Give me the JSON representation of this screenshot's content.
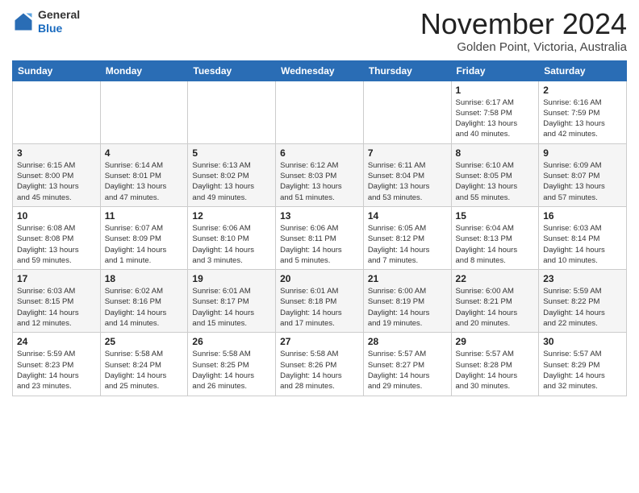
{
  "header": {
    "logo": {
      "line1": "General",
      "line2": "Blue"
    },
    "title": "November 2024",
    "location": "Golden Point, Victoria, Australia"
  },
  "calendar": {
    "weekdays": [
      "Sunday",
      "Monday",
      "Tuesday",
      "Wednesday",
      "Thursday",
      "Friday",
      "Saturday"
    ],
    "weeks": [
      [
        {
          "day": "",
          "info": ""
        },
        {
          "day": "",
          "info": ""
        },
        {
          "day": "",
          "info": ""
        },
        {
          "day": "",
          "info": ""
        },
        {
          "day": "",
          "info": ""
        },
        {
          "day": "1",
          "info": "Sunrise: 6:17 AM\nSunset: 7:58 PM\nDaylight: 13 hours\nand 40 minutes."
        },
        {
          "day": "2",
          "info": "Sunrise: 6:16 AM\nSunset: 7:59 PM\nDaylight: 13 hours\nand 42 minutes."
        }
      ],
      [
        {
          "day": "3",
          "info": "Sunrise: 6:15 AM\nSunset: 8:00 PM\nDaylight: 13 hours\nand 45 minutes."
        },
        {
          "day": "4",
          "info": "Sunrise: 6:14 AM\nSunset: 8:01 PM\nDaylight: 13 hours\nand 47 minutes."
        },
        {
          "day": "5",
          "info": "Sunrise: 6:13 AM\nSunset: 8:02 PM\nDaylight: 13 hours\nand 49 minutes."
        },
        {
          "day": "6",
          "info": "Sunrise: 6:12 AM\nSunset: 8:03 PM\nDaylight: 13 hours\nand 51 minutes."
        },
        {
          "day": "7",
          "info": "Sunrise: 6:11 AM\nSunset: 8:04 PM\nDaylight: 13 hours\nand 53 minutes."
        },
        {
          "day": "8",
          "info": "Sunrise: 6:10 AM\nSunset: 8:05 PM\nDaylight: 13 hours\nand 55 minutes."
        },
        {
          "day": "9",
          "info": "Sunrise: 6:09 AM\nSunset: 8:07 PM\nDaylight: 13 hours\nand 57 minutes."
        }
      ],
      [
        {
          "day": "10",
          "info": "Sunrise: 6:08 AM\nSunset: 8:08 PM\nDaylight: 13 hours\nand 59 minutes."
        },
        {
          "day": "11",
          "info": "Sunrise: 6:07 AM\nSunset: 8:09 PM\nDaylight: 14 hours\nand 1 minute."
        },
        {
          "day": "12",
          "info": "Sunrise: 6:06 AM\nSunset: 8:10 PM\nDaylight: 14 hours\nand 3 minutes."
        },
        {
          "day": "13",
          "info": "Sunrise: 6:06 AM\nSunset: 8:11 PM\nDaylight: 14 hours\nand 5 minutes."
        },
        {
          "day": "14",
          "info": "Sunrise: 6:05 AM\nSunset: 8:12 PM\nDaylight: 14 hours\nand 7 minutes."
        },
        {
          "day": "15",
          "info": "Sunrise: 6:04 AM\nSunset: 8:13 PM\nDaylight: 14 hours\nand 8 minutes."
        },
        {
          "day": "16",
          "info": "Sunrise: 6:03 AM\nSunset: 8:14 PM\nDaylight: 14 hours\nand 10 minutes."
        }
      ],
      [
        {
          "day": "17",
          "info": "Sunrise: 6:03 AM\nSunset: 8:15 PM\nDaylight: 14 hours\nand 12 minutes."
        },
        {
          "day": "18",
          "info": "Sunrise: 6:02 AM\nSunset: 8:16 PM\nDaylight: 14 hours\nand 14 minutes."
        },
        {
          "day": "19",
          "info": "Sunrise: 6:01 AM\nSunset: 8:17 PM\nDaylight: 14 hours\nand 15 minutes."
        },
        {
          "day": "20",
          "info": "Sunrise: 6:01 AM\nSunset: 8:18 PM\nDaylight: 14 hours\nand 17 minutes."
        },
        {
          "day": "21",
          "info": "Sunrise: 6:00 AM\nSunset: 8:19 PM\nDaylight: 14 hours\nand 19 minutes."
        },
        {
          "day": "22",
          "info": "Sunrise: 6:00 AM\nSunset: 8:21 PM\nDaylight: 14 hours\nand 20 minutes."
        },
        {
          "day": "23",
          "info": "Sunrise: 5:59 AM\nSunset: 8:22 PM\nDaylight: 14 hours\nand 22 minutes."
        }
      ],
      [
        {
          "day": "24",
          "info": "Sunrise: 5:59 AM\nSunset: 8:23 PM\nDaylight: 14 hours\nand 23 minutes."
        },
        {
          "day": "25",
          "info": "Sunrise: 5:58 AM\nSunset: 8:24 PM\nDaylight: 14 hours\nand 25 minutes."
        },
        {
          "day": "26",
          "info": "Sunrise: 5:58 AM\nSunset: 8:25 PM\nDaylight: 14 hours\nand 26 minutes."
        },
        {
          "day": "27",
          "info": "Sunrise: 5:58 AM\nSunset: 8:26 PM\nDaylight: 14 hours\nand 28 minutes."
        },
        {
          "day": "28",
          "info": "Sunrise: 5:57 AM\nSunset: 8:27 PM\nDaylight: 14 hours\nand 29 minutes."
        },
        {
          "day": "29",
          "info": "Sunrise: 5:57 AM\nSunset: 8:28 PM\nDaylight: 14 hours\nand 30 minutes."
        },
        {
          "day": "30",
          "info": "Sunrise: 5:57 AM\nSunset: 8:29 PM\nDaylight: 14 hours\nand 32 minutes."
        }
      ]
    ]
  }
}
